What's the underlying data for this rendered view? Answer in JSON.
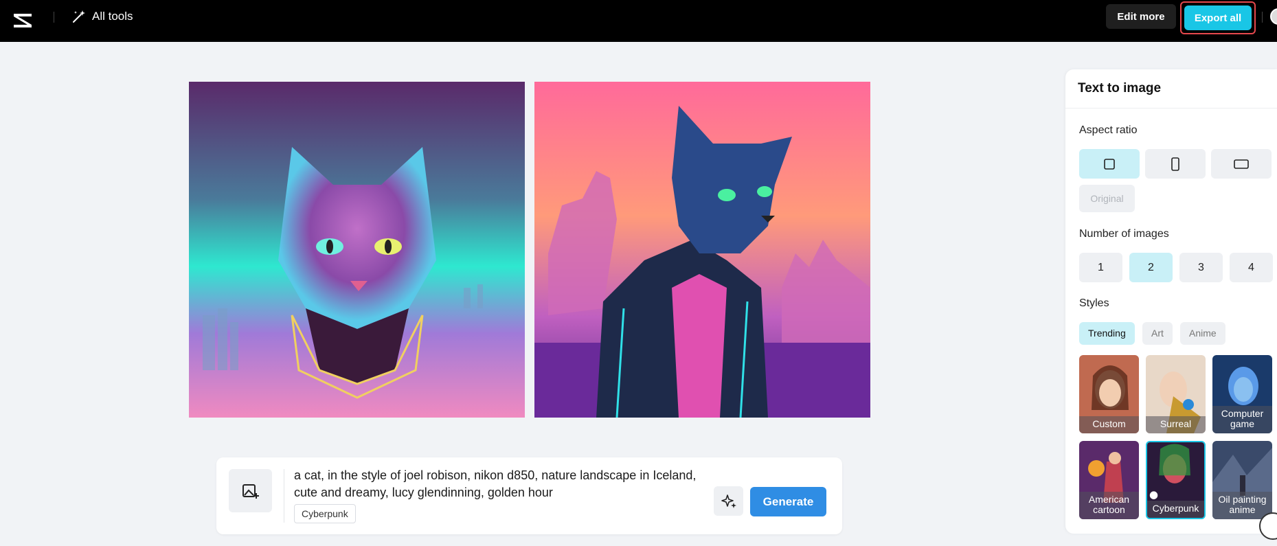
{
  "topbar": {
    "all_tools_label": "All tools",
    "edit_more_label": "Edit more",
    "export_all_label": "Export all"
  },
  "images": [
    {
      "alt": "Generated image 1"
    },
    {
      "alt": "Generated image 2"
    }
  ],
  "prompt": {
    "text": "a cat, in the style of joel robison, nikon d850, nature landscape in Iceland, cute and dreamy, lucy glendinning, golden hour",
    "style_tag": "Cyberpunk",
    "generate_label": "Generate"
  },
  "panel": {
    "title": "Text to image",
    "aspect_ratio_label": "Aspect ratio",
    "aspect_ratios": [
      "square",
      "portrait",
      "landscape"
    ],
    "selected_ratio": "square",
    "original_label": "Original",
    "number_label": "Number of images",
    "numbers": [
      "1",
      "2",
      "3",
      "4"
    ],
    "selected_number": "2",
    "styles_label": "Styles",
    "style_tabs": [
      "Trending",
      "Art",
      "Anime"
    ],
    "selected_tab": "Trending",
    "style_cards": [
      {
        "label": "Custom"
      },
      {
        "label": "Surreal"
      },
      {
        "label": "Computer game"
      },
      {
        "label": "American cartoon"
      },
      {
        "label": "Cyberpunk"
      },
      {
        "label": "Oil painting anime"
      }
    ],
    "selected_style": "Cyberpunk"
  },
  "colors": {
    "accent": "#19c6e6",
    "generate": "#2f8de4",
    "selected_bg": "#c9f0f7",
    "highlight_border": "#e5484d"
  }
}
